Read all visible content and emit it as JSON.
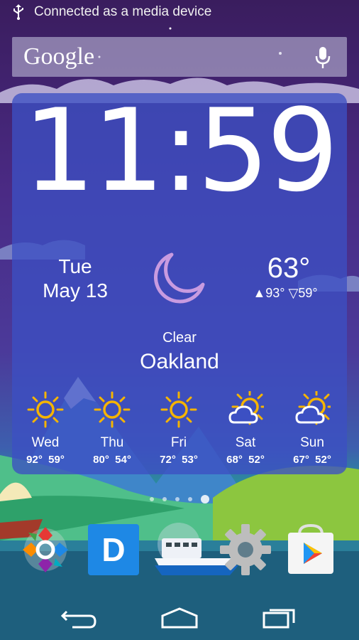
{
  "status_bar": {
    "notification_text": "Connected as a media device",
    "icon": "usb-icon"
  },
  "search": {
    "logo_text": "Google",
    "icon": "mic-icon"
  },
  "weather": {
    "time_hours": "11",
    "time_minutes": "59",
    "day": "Tue",
    "date": "May 13",
    "current_icon": "moon-icon",
    "temperature": "63°",
    "high": "▲93°",
    "low": "▽59°",
    "condition": "Clear",
    "city": "Oakland",
    "forecast": [
      {
        "day": "Wed",
        "high": "92°",
        "low": "59°",
        "icon": "sun-icon"
      },
      {
        "day": "Thu",
        "high": "80°",
        "low": "54°",
        "icon": "sun-icon"
      },
      {
        "day": "Fri",
        "high": "72°",
        "low": "53°",
        "icon": "sun-icon"
      },
      {
        "day": "Sat",
        "high": "68°",
        "low": "52°",
        "icon": "partly-cloudy-icon"
      },
      {
        "day": "Sun",
        "high": "67°",
        "low": "52°",
        "icon": "partly-cloudy-icon"
      }
    ],
    "colors": {
      "sun": "#f5b400",
      "moon": "#c89be0",
      "card": "#3c50c3"
    }
  },
  "home": {
    "page_count": 5,
    "active_page": 5,
    "dock_apps": [
      {
        "name": "app-launcher-icon"
      },
      {
        "name": "dashlane-icon",
        "letter": "D"
      },
      {
        "name": "ferry-app-icon"
      },
      {
        "name": "settings-icon"
      },
      {
        "name": "play-store-icon"
      }
    ]
  },
  "nav": {
    "back": "back-icon",
    "home": "home-icon",
    "recents": "recents-icon"
  }
}
